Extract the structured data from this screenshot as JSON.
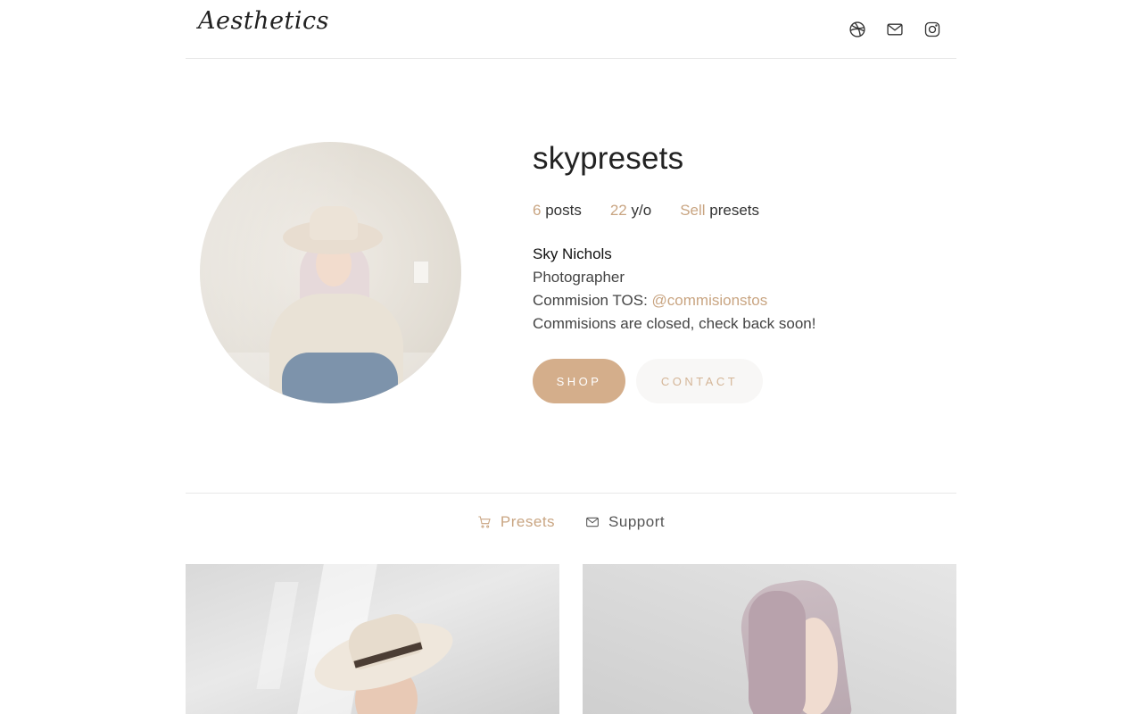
{
  "header": {
    "logo": "Aesthetics",
    "icons": [
      "dribbble-icon",
      "mail-icon",
      "instagram-icon"
    ]
  },
  "profile": {
    "username": "skypresets",
    "stats": [
      {
        "num": "6",
        "label": "posts"
      },
      {
        "num": "22",
        "label": "y/o"
      },
      {
        "num": "Sell",
        "label": "presets"
      }
    ],
    "bio": {
      "name": "Sky Nichols",
      "title": "Photographer",
      "tos_label": "Commision TOS: ",
      "tos_link": "@commisionstos",
      "status": "Commisions are closed, check back soon!"
    },
    "buttons": {
      "shop": "SHOP",
      "contact": "CONTACT"
    }
  },
  "tabs": [
    {
      "label": "Presets",
      "icon": "cart-icon",
      "active": true
    },
    {
      "label": "Support",
      "icon": "mail-icon",
      "active": false
    }
  ],
  "colors": {
    "accent": "#c9a582",
    "shop_button": "#d4ae8b",
    "contact_button_bg": "#f8f7f6"
  }
}
